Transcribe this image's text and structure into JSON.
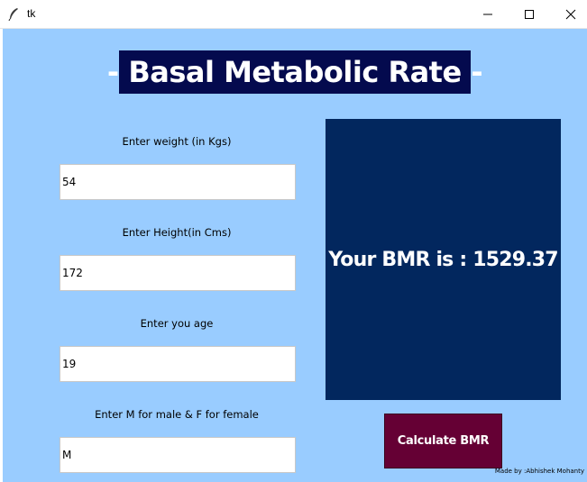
{
  "window": {
    "title": "tk",
    "app_icon": "feather-icon",
    "controls": [
      "minimize-icon",
      "maximize-icon",
      "close-icon"
    ]
  },
  "header": {
    "title": "- Basal Metabolic Rate -"
  },
  "form": {
    "weight_label": "Enter weight (in Kgs)",
    "weight_value": "54",
    "height_label": "Enter Height(in Cms)",
    "height_value": "172",
    "age_label": "Enter you age",
    "age_value": "19",
    "gender_label": "Enter M for male & F for female",
    "gender_value": "M"
  },
  "result": {
    "text": "Your BMR is : 1529.37"
  },
  "button": {
    "label": "Calculate BMR"
  },
  "credit": "Made by :Abhishek Mohanty",
  "colors": {
    "client_bg": "#99ccff",
    "header_bg": "#040a4e",
    "result_bg": "#02275e",
    "button_bg": "#650034"
  }
}
